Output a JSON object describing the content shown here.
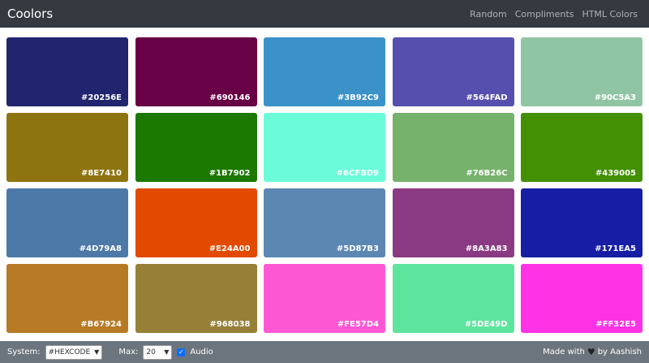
{
  "navbar": {
    "brand": "Coolors",
    "links": [
      "Random",
      "Compliments",
      "HTML Colors"
    ]
  },
  "swatches": [
    {
      "code": "#20256E",
      "color": "#20256E"
    },
    {
      "code": "#690146",
      "color": "#690146"
    },
    {
      "code": "#3B92C9",
      "color": "#3B92C9"
    },
    {
      "code": "#564FAD",
      "color": "#564FAD"
    },
    {
      "code": "#90C5A3",
      "color": "#90C5A3"
    },
    {
      "code": "#8E7410",
      "color": "#8E7410"
    },
    {
      "code": "#1B7902",
      "color": "#1B7902"
    },
    {
      "code": "#6CFBD9",
      "color": "#6CFBD9"
    },
    {
      "code": "#76B26C",
      "color": "#76B26C"
    },
    {
      "code": "#439005",
      "color": "#439005"
    },
    {
      "code": "#4D79A8",
      "color": "#4D79A8"
    },
    {
      "code": "#E24A00",
      "color": "#E24A00"
    },
    {
      "code": "#5D87B3",
      "color": "#5D87B3"
    },
    {
      "code": "#8A3A83",
      "color": "#8A3A83"
    },
    {
      "code": "#171EA5",
      "color": "#171EA5"
    },
    {
      "code": "#B67924",
      "color": "#B67924"
    },
    {
      "code": "#968038",
      "color": "#968038"
    },
    {
      "code": "#FE57D4",
      "color": "#FE57D4"
    },
    {
      "code": "#5DE49D",
      "color": "#5DE49D"
    },
    {
      "code": "#FF32E5",
      "color": "#FF32E5"
    }
  ],
  "footer": {
    "system_label": "System:",
    "system_value": "#HEXCODE",
    "max_label": "Max:",
    "max_value": "20",
    "audio_label": "Audio",
    "audio_checked": true,
    "made_with": "Made with",
    "heart_icon": "heart-icon",
    "by": "by Aashish"
  }
}
